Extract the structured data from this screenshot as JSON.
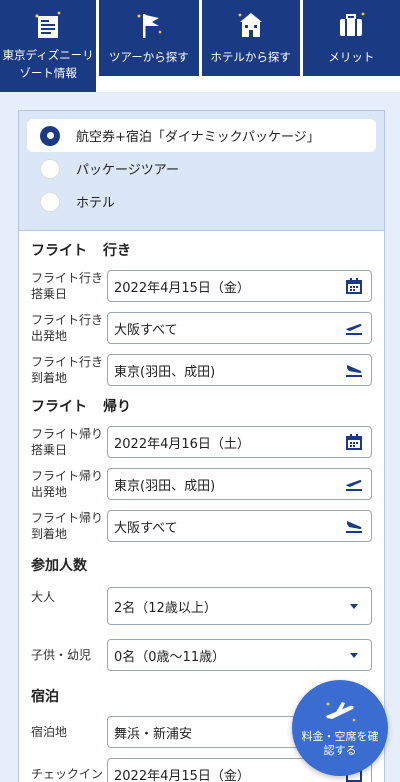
{
  "tabs": [
    {
      "label": "東京ディズニーリゾート情報",
      "icon": "map-pin-guide-icon"
    },
    {
      "label": "ツアーから探す",
      "icon": "flag-icon"
    },
    {
      "label": "ホテルから探す",
      "icon": "hotel-icon"
    },
    {
      "label": "メリット",
      "icon": "suitcase-icon"
    }
  ],
  "search_type": {
    "options": [
      "航空券+宿泊「ダイナミックパッケージ」",
      "パッケージツアー",
      "ホテル"
    ],
    "selected": 0
  },
  "flight_out": {
    "title": "フライト",
    "sub": "行き",
    "date_label": "フライト行き搭乗日",
    "date_value": "2022年4月15日（金）",
    "from_label": "フライト行き出発地",
    "from_value": "大阪すべて",
    "to_label": "フライト行き到着地",
    "to_value": "東京(羽田、成田)"
  },
  "flight_back": {
    "title": "フライト",
    "sub": "帰り",
    "date_label": "フライト帰り搭乗日",
    "date_value": "2022年4月16日（土）",
    "from_label": "フライト帰り出発地",
    "from_value": "東京(羽田、成田)",
    "to_label": "フライト帰り到着地",
    "to_value": "大阪すべて"
  },
  "people": {
    "title": "参加人数",
    "adult_label": "大人",
    "adult_value": "2名（12歳以上）",
    "child_label": "子供・幼児",
    "child_value": "0名（0歳〜11歳）"
  },
  "stay": {
    "title": "宿泊",
    "area_label": "宿泊地",
    "area_value": "舞浜・新浦安",
    "checkin_label": "チェックイン",
    "checkin_value": "2022年4月15日（金）"
  },
  "fab": {
    "label": "料金・空席を確認する",
    "icon": "airplane-icon"
  },
  "colors": {
    "navy": "#1a3a84",
    "accent_blue": "#3b6ccf",
    "bg": "#e6eef9"
  }
}
